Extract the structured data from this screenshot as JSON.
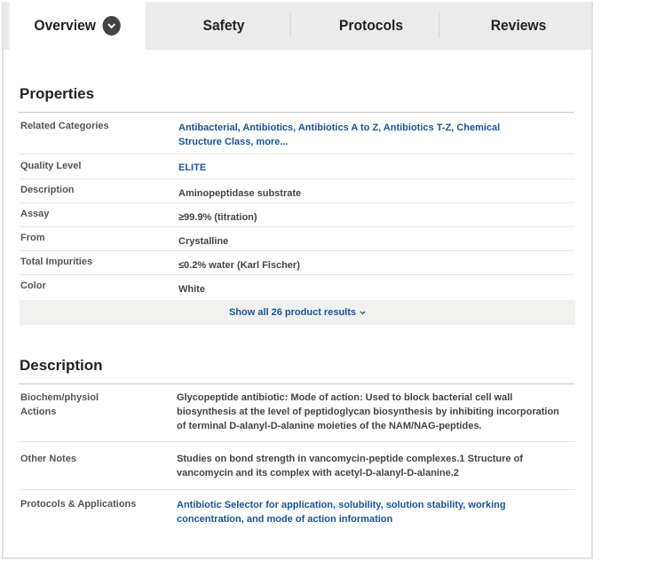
{
  "tabs": [
    {
      "label": "Overview",
      "active": true
    },
    {
      "label": "Safety"
    },
    {
      "label": "Protocols"
    },
    {
      "label": "Reviews"
    }
  ],
  "properties": {
    "title": "Properties",
    "rows": [
      {
        "label": "Related Categories",
        "value_line1": "Antibacterial, Antibiotics, Antibiotics A to Z, Antibiotics T-Z, Chemical",
        "value_line2": "Structure Class, more...",
        "link": true
      },
      {
        "label": "Quality Level",
        "value": "ELITE",
        "link": true
      },
      {
        "label": "Description",
        "value": "Aminopeptidase substrate"
      },
      {
        "label": "Assay",
        "value": "≥99.9% (titration)"
      },
      {
        "label": "From",
        "value": "Crystalline"
      },
      {
        "label": "Total Impurities",
        "value": "≤0.2% water (Karl Fischer)"
      },
      {
        "label": "Color",
        "value": "White"
      }
    ],
    "show_all": "Show all 26 product results"
  },
  "description": {
    "title": "Description",
    "rows": [
      {
        "label_line1": "Biochem/physiol",
        "label_line2": "Actions",
        "lines": [
          "Glycopeptide antibiotic: Mode of action: Used to block bacterial cell wall",
          "biosynthesis at the level of peptidoglycan biosynthesis by inhibiting incorporation",
          "of terminal D-alanyl-D-alanine moieties of the NAM/NAG-peptides."
        ]
      },
      {
        "label": "Other Notes",
        "lines": [
          "Studies on bond strength in vancomycin-peptide complexes.1 Structure of",
          "vancomycin and its complex with acetyl-D-alanyl-D-alanine.2"
        ]
      },
      {
        "label": "Protocols & Applications",
        "link": true,
        "lines": [
          "Antibiotic Selector for application, solubility, solution stability, working",
          "concentration, and mode of action information"
        ]
      }
    ]
  },
  "colors": {
    "link": "#1a5496",
    "tab_bar": "#ebebeb",
    "chevron_bg": "#444444"
  },
  "icons": {
    "tab_dropdown": "chevron-down-icon",
    "show_all": "chevron-down-icon"
  }
}
